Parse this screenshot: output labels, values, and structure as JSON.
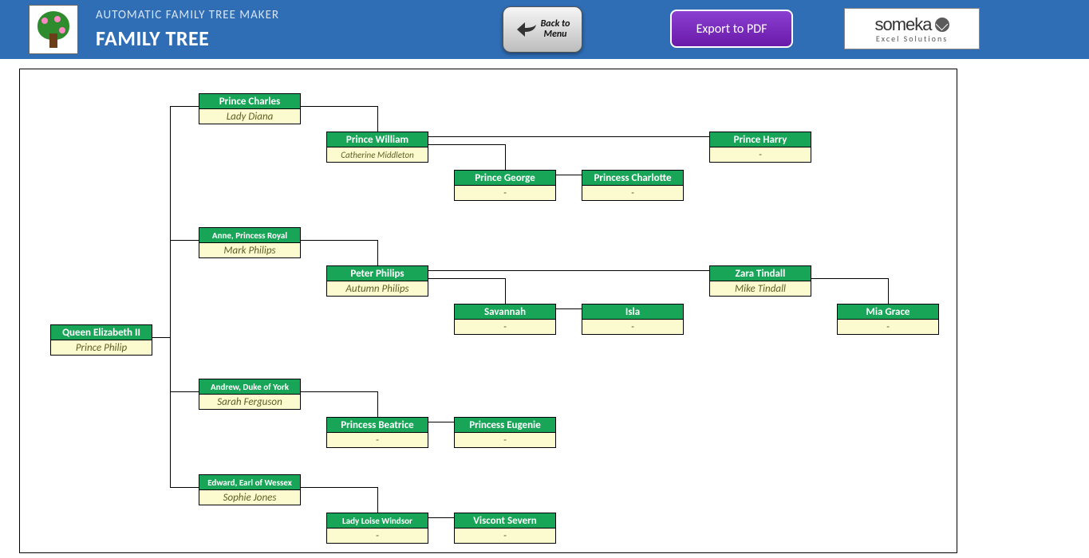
{
  "header": {
    "subtitle": "AUTOMATIC FAMILY TREE MAKER",
    "title": "FAMILY TREE",
    "back_line1": "Back to",
    "back_line2": "Menu",
    "export": "Export to PDF",
    "brand": "someka",
    "brand_sub": "Excel Solutions"
  },
  "people": {
    "root": {
      "name": "Queen Elizabeth II",
      "spouse": "Prince Philip"
    },
    "charles": {
      "name": "Prince Charles",
      "spouse": "Lady Diana"
    },
    "william": {
      "name": "Prince William",
      "spouse": "Catherine Middleton"
    },
    "george": {
      "name": "Prince George",
      "spouse": "-"
    },
    "charlotte": {
      "name": "Princess Charlotte",
      "spouse": "-"
    },
    "harry": {
      "name": "Prince Harry",
      "spouse": "-"
    },
    "anne": {
      "name": "Anne, Princess Royal",
      "spouse": "Mark Philips"
    },
    "peter": {
      "name": "Peter Philips",
      "spouse": "Autumn Philips"
    },
    "savannah": {
      "name": "Savannah",
      "spouse": "-"
    },
    "isla": {
      "name": "Isla",
      "spouse": "-"
    },
    "zara": {
      "name": "Zara Tindall",
      "spouse": "Mike Tindall"
    },
    "mia": {
      "name": "Mia Grace",
      "spouse": "-"
    },
    "andrew": {
      "name": "Andrew, Duke of York",
      "spouse": "Sarah Ferguson"
    },
    "beatrice": {
      "name": "Princess Beatrice",
      "spouse": "-"
    },
    "eugenie": {
      "name": "Princess Eugenie",
      "spouse": "-"
    },
    "edward": {
      "name": "Edward, Earl of Wessex",
      "spouse": "Sophie Jones"
    },
    "loise": {
      "name": "Lady Loise Windsor",
      "spouse": "-"
    },
    "severn": {
      "name": "Viscont Severn",
      "spouse": "-"
    }
  }
}
